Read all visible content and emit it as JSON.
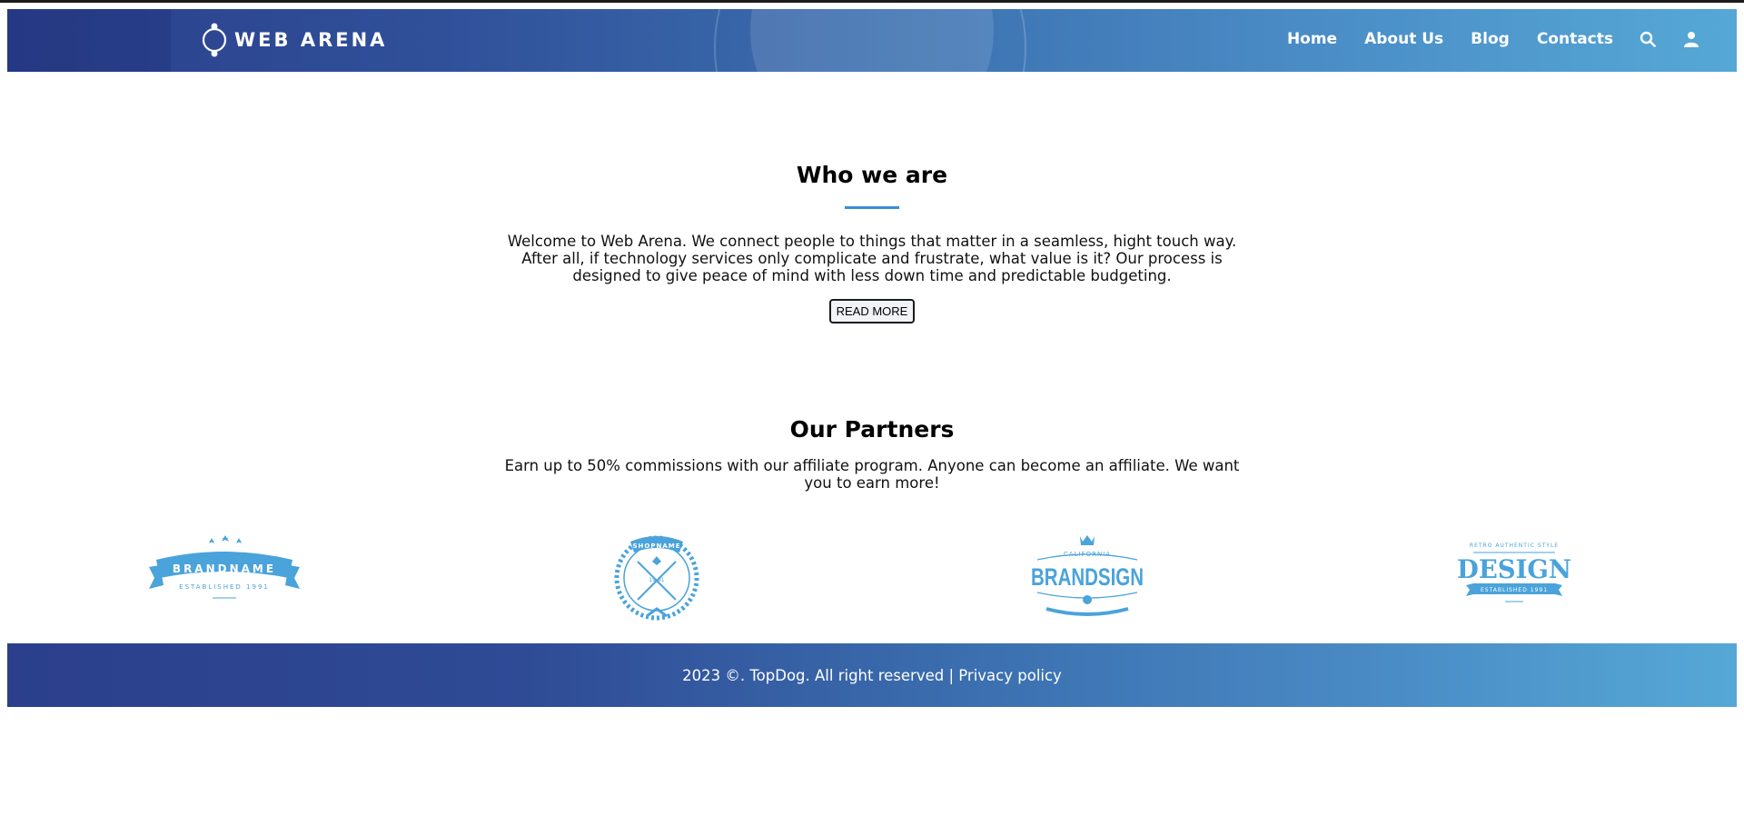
{
  "header": {
    "logo_text": "WEB ARENA",
    "nav": [
      {
        "label": "Home"
      },
      {
        "label": "About Us"
      },
      {
        "label": "Blog"
      },
      {
        "label": "Contacts"
      }
    ],
    "icons": [
      "search-icon",
      "user-icon"
    ]
  },
  "who": {
    "title": "Who we are",
    "text": "Welcome to Web Arena. We connect people to things that matter in a seamless, hight touch way. After all, if technology services only complicate and frustrate, what value is it? Our process is designed to give peace of mind with less down time and predictable budgeting.",
    "button": "READ MORE"
  },
  "partners": {
    "title": "Our Partners",
    "text": "Earn up to 50% commissions with our affiliate program. Anyone can become an affiliate. We want you to earn more!",
    "logos": [
      {
        "name": "BRANDNAME",
        "sub": "ESTABLISHED 1991"
      },
      {
        "name": "SHOPNAME",
        "sub": "19 91"
      },
      {
        "name": "BRANDSIGN",
        "top": "CALIFORNIA"
      },
      {
        "name": "DESIGN",
        "top": "RETRO AUTHENTIC STYLE",
        "sub": "ESTABLISHED 1991"
      }
    ]
  },
  "footer": {
    "copyright": "2023 ©. TopDog. All right reserved | ",
    "privacy": "Privacy policy"
  },
  "colors": {
    "header_start": "#2b3f8c",
    "header_end": "#55a8d6",
    "accent": "#3a8fd6",
    "logo_blue": "#4aa3da"
  }
}
